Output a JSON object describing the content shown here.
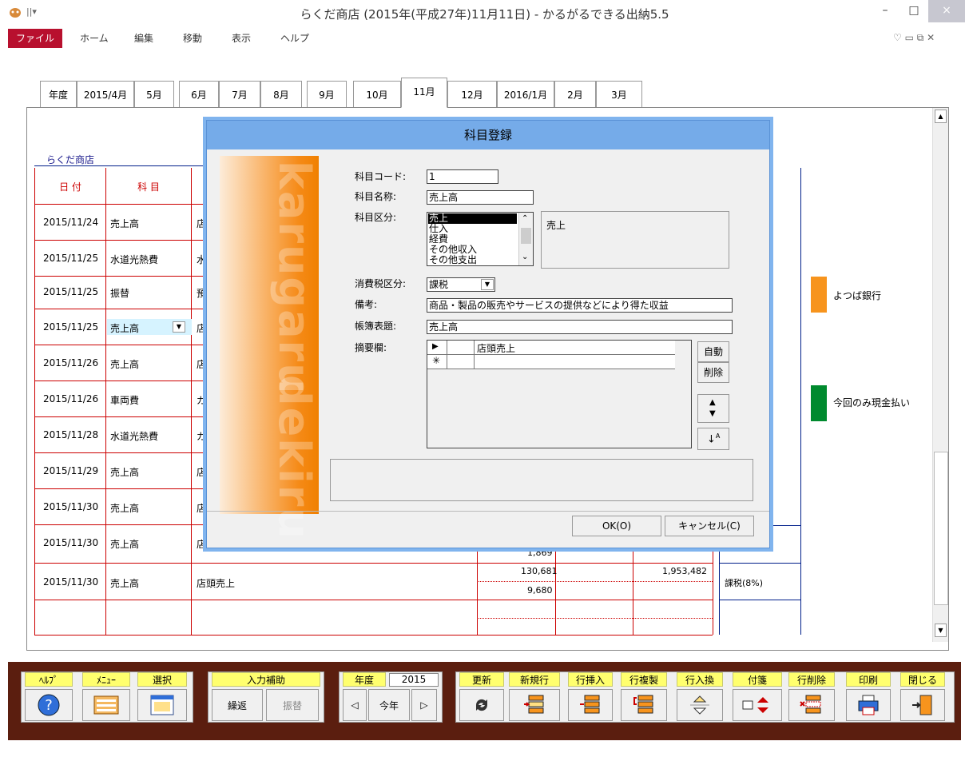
{
  "window": {
    "title": "らくだ商店 (2015年(平成27年)11月11日) - かるがるできる出納5.5",
    "controls": [
      "–",
      "□",
      "×"
    ]
  },
  "menu": {
    "items": [
      "ファイル",
      "ホーム",
      "編集",
      "移動",
      "表示",
      "ヘルプ"
    ]
  },
  "tabs": [
    "年度",
    "2015/4月",
    "5月",
    "6月",
    "7月",
    "8月",
    "9月",
    "10月",
    "11月",
    "12月",
    "2016/1月",
    "2月",
    "3月"
  ],
  "sheet": {
    "shop_name": "らくだ商店",
    "col_date": "日 付",
    "col_subject": "科 目",
    "rows": [
      {
        "date": "2015/11/24",
        "subject": "売上高",
        "desc": "店"
      },
      {
        "date": "2015/11/25",
        "subject": "水道光熱費",
        "desc": "水"
      },
      {
        "date": "2015/11/25",
        "subject": "振替",
        "desc": "預"
      },
      {
        "date": "2015/11/25",
        "subject": "売上高",
        "desc": "店"
      },
      {
        "date": "2015/11/26",
        "subject": "売上高",
        "desc": "店"
      },
      {
        "date": "2015/11/26",
        "subject": "車両費",
        "desc": "ガ"
      },
      {
        "date": "2015/11/28",
        "subject": "水道光熱費",
        "desc": "ガ"
      },
      {
        "date": "2015/11/29",
        "subject": "売上高",
        "desc": "店"
      },
      {
        "date": "2015/11/30",
        "subject": "売上高",
        "desc": "店"
      },
      {
        "date": "2015/11/30",
        "subject": "売上高",
        "desc": "店頭売上"
      },
      {
        "date": "2015/11/30",
        "subject": "売上高",
        "desc": "店頭売上"
      }
    ],
    "row10_amount_bottom": "1,869",
    "row11_amount_top": "130,681",
    "row11_amount_bottom": "9,680",
    "row11_balance": "1,953,482",
    "row11_tax": "課税(8%)",
    "legend_bank": "よつば銀行",
    "legend_cash": "今回のみ現金払い"
  },
  "dialog": {
    "title": "科目登録",
    "deco_text_top": "karugaru",
    "deco_text_bottom": "dekiru",
    "label_code": "科目コード:",
    "code": "1",
    "label_name": "科目名称:",
    "name": "売上高",
    "label_category": "科目区分:",
    "category_options": [
      "売上",
      "仕入",
      "経費",
      "その他収入",
      "その他支出"
    ],
    "category_selected": "売上",
    "label_tax": "消費税区分:",
    "tax": "課税",
    "label_note": "備考:",
    "note": "商品・製品の販売やサービスの提供などにより得た収益",
    "label_ledger": "帳簿表題:",
    "ledger": "売上高",
    "label_summary": "摘要欄:",
    "summary_row": "店頭売上",
    "btn_auto": "自動",
    "btn_delete": "削除",
    "btn_ok": "OK(O)",
    "btn_cancel": "キャンセル(C)"
  },
  "toolbar": {
    "help": "ﾍﾙﾌﾟ",
    "menu": "ﾒﾆｭｰ",
    "select": "選択",
    "input_assist": "入力補助",
    "repeat": "繰返",
    "transfer": "振替",
    "year_label": "年度",
    "year_value": "2015",
    "this_year": "今年",
    "update": "更新",
    "new_row": "新規行",
    "insert_row": "行挿入",
    "copy_row": "行複製",
    "swap_row": "行入換",
    "sticky": "付箋",
    "delete_row": "行削除",
    "print": "印刷",
    "close": "閉じる"
  }
}
